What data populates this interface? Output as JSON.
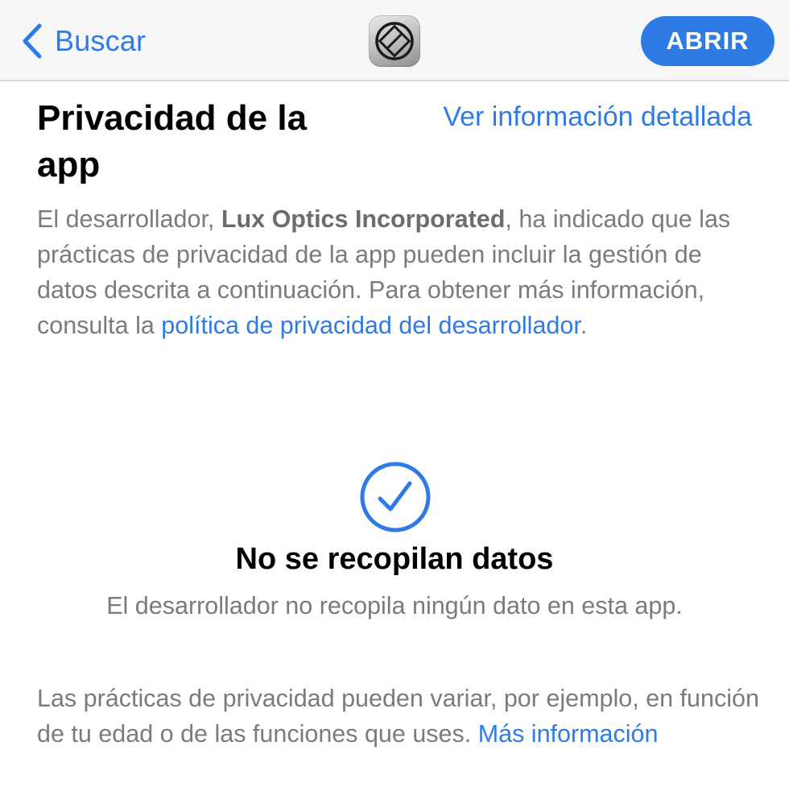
{
  "navbar": {
    "back_label": "Buscar",
    "open_label": "ABRIR",
    "app_icon": "halide-app-icon"
  },
  "privacy": {
    "title": "Privacidad de la app",
    "detail_link": "Ver información detallada",
    "description": {
      "part1": "El desarrollador, ",
      "developer": "Lux Optics Incorporated",
      "part2": ", ha indicado que las prácticas de privacidad de la app pueden incluir la gestión de datos descrita a continuación. Para obtener más información, consulta la ",
      "policy_link": "política de privacidad del desarrollador",
      "part3": "."
    }
  },
  "no_data": {
    "icon": "checkmark-circle-icon",
    "title": "No se recopilan datos",
    "subtitle": "El desarrollador no recopila ningún dato en esta app."
  },
  "footer": {
    "text": "Las prácticas de privacidad pueden variar, por ejemplo, en función de tu edad o de las funciones que uses. ",
    "more_link": "Más información"
  },
  "colors": {
    "accent": "#2f7be6",
    "secondary_text": "#7a7a80",
    "navbar_bg": "#f7f7f8"
  }
}
